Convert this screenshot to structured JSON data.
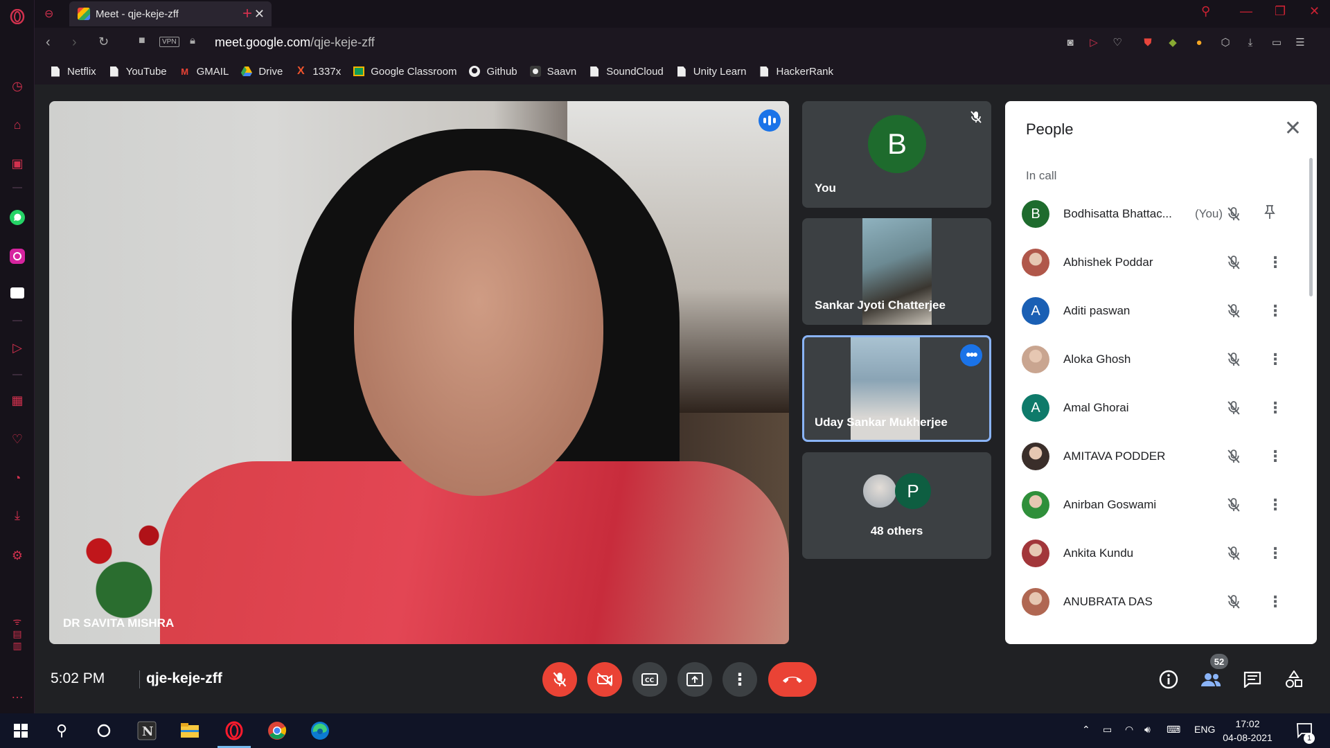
{
  "browser": {
    "tab_title": "Meet - qje-keje-zff",
    "url_domain": "meet.google.com",
    "url_path": "/qje-keje-zff",
    "vpn_label": "VPN"
  },
  "bookmarks": [
    {
      "label": "Netflix",
      "icon": "doc"
    },
    {
      "label": "YouTube",
      "icon": "doc"
    },
    {
      "label": "GMAIL",
      "icon": "gmail"
    },
    {
      "label": "Drive",
      "icon": "drive"
    },
    {
      "label": "1337x",
      "icon": "x"
    },
    {
      "label": "Google Classroom",
      "icon": "classroom"
    },
    {
      "label": "Github",
      "icon": "github"
    },
    {
      "label": "Saavn",
      "icon": "saavn"
    },
    {
      "label": "SoundCloud",
      "icon": "doc"
    },
    {
      "label": "Unity Learn",
      "icon": "doc"
    },
    {
      "label": "HackerRank",
      "icon": "doc"
    }
  ],
  "meet": {
    "main_speaker": "DR SAVITA MISHRA",
    "tiles": {
      "you_label": "You",
      "you_initial": "B",
      "tile2_name": "Sankar Jyoti Chatterjee",
      "tile3_name": "Uday Sankar Mukherjee",
      "others_label": "48 others",
      "others_initial": "P"
    },
    "time": "5:02 PM",
    "code": "qje-keje-zff",
    "people_count": "52"
  },
  "people_panel": {
    "title": "People",
    "section": "In call",
    "you_suffix": "(You)",
    "participants": [
      {
        "name": "Bodhisatta Bhattac...",
        "initial": "B",
        "avatar_color": "#1e6b2d",
        "photo": false
      },
      {
        "name": "Abhishek Poddar",
        "initial": "",
        "avatar_color": "#b0574a",
        "photo": true
      },
      {
        "name": "Aditi paswan",
        "initial": "A",
        "avatar_color": "#1a5fb4",
        "photo": false
      },
      {
        "name": "Aloka Ghosh",
        "initial": "",
        "avatar_color": "#c9a590",
        "photo": true
      },
      {
        "name": "Amal Ghorai",
        "initial": "A",
        "avatar_color": "#0e7a6a",
        "photo": false
      },
      {
        "name": "AMITAVA PODDER",
        "initial": "",
        "avatar_color": "#3a2e2a",
        "photo": true
      },
      {
        "name": "Anirban Goswami",
        "initial": "",
        "avatar_color": "#2f8f3a",
        "photo": true
      },
      {
        "name": "Ankita Kundu",
        "initial": "",
        "avatar_color": "#a2363a",
        "photo": true
      },
      {
        "name": "ANUBRATA DAS",
        "initial": "",
        "avatar_color": "#b06752",
        "photo": true
      }
    ]
  },
  "taskbar": {
    "lang": "ENG",
    "time": "17:02",
    "date": "04-08-2021",
    "notif_count": "1"
  }
}
